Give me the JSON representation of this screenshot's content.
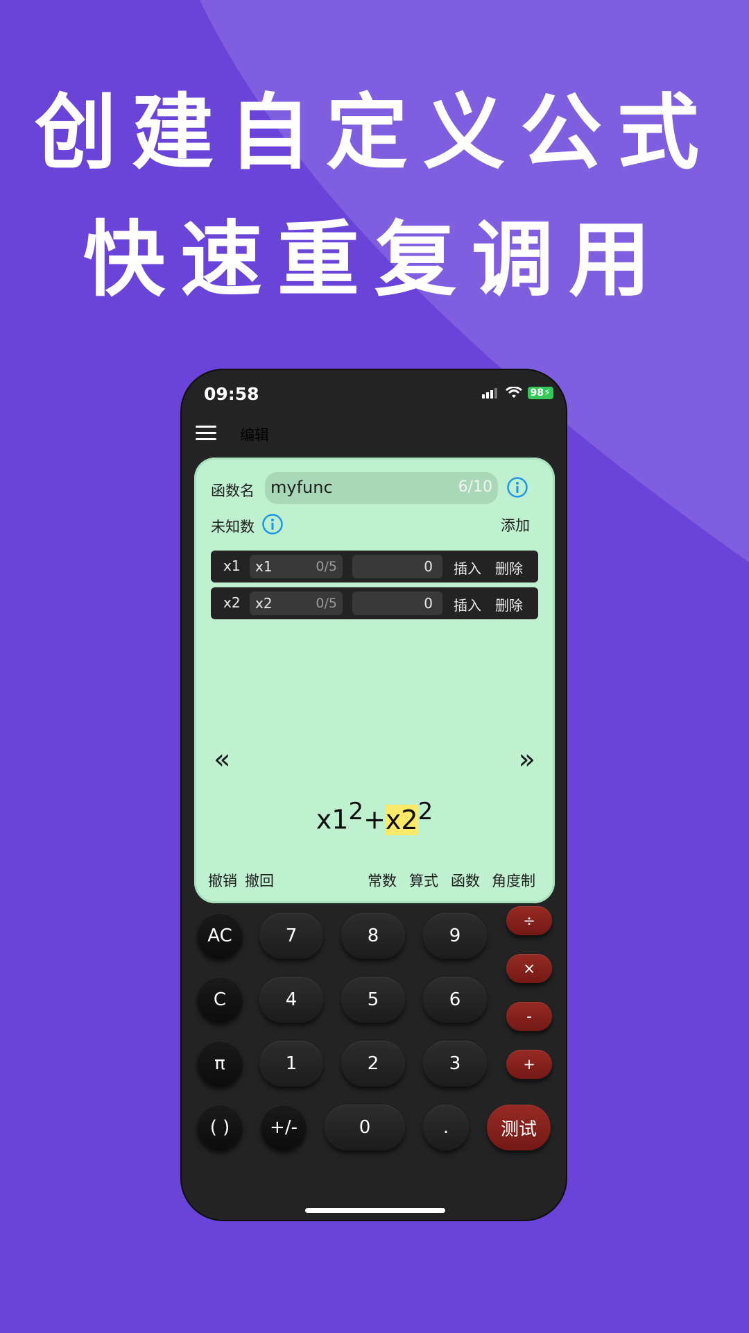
{
  "headline": {
    "line1": "创建自定义公式",
    "line2": "快速重复调用"
  },
  "status_bar": {
    "time": "09:58",
    "battery": "98"
  },
  "nav": {
    "title": "编辑"
  },
  "editor": {
    "name_label": "函数名",
    "name_value": "myfunc",
    "name_count": "6/10",
    "unknowns_label": "未知数",
    "add_label": "添加",
    "variables": [
      {
        "label": "x1",
        "name": "x1",
        "count": "0/5",
        "value": "0",
        "insert": "插入",
        "delete": "删除"
      },
      {
        "label": "x2",
        "name": "x2",
        "count": "0/5",
        "value": "0",
        "insert": "插入",
        "delete": "删除"
      }
    ],
    "arrow_left": "«",
    "arrow_right": "»",
    "formula": {
      "a": "x1",
      "a_exp": "2",
      "op": "+",
      "b": "x2",
      "b_exp": "2"
    },
    "actions": {
      "undo": "撤销",
      "redo": "撤回",
      "constants": "常数",
      "expressions": "算式",
      "functions": "函数",
      "angle": "角度制"
    }
  },
  "keypad": {
    "ac": "AC",
    "c": "C",
    "pi": "π",
    "paren": "( )",
    "sign": "+/-",
    "d7": "7",
    "d8": "8",
    "d9": "9",
    "d4": "4",
    "d5": "5",
    "d6": "6",
    "d1": "1",
    "d2": "2",
    "d3": "3",
    "d0": "0",
    "dot": ".",
    "divide": "÷",
    "multiply": "×",
    "minus": "-",
    "plus": "+",
    "test": "测试"
  },
  "colors": {
    "background": "#6a43d9",
    "panel": "#bff0d0",
    "operator": "#8a241e",
    "highlight": "#fbe969"
  }
}
